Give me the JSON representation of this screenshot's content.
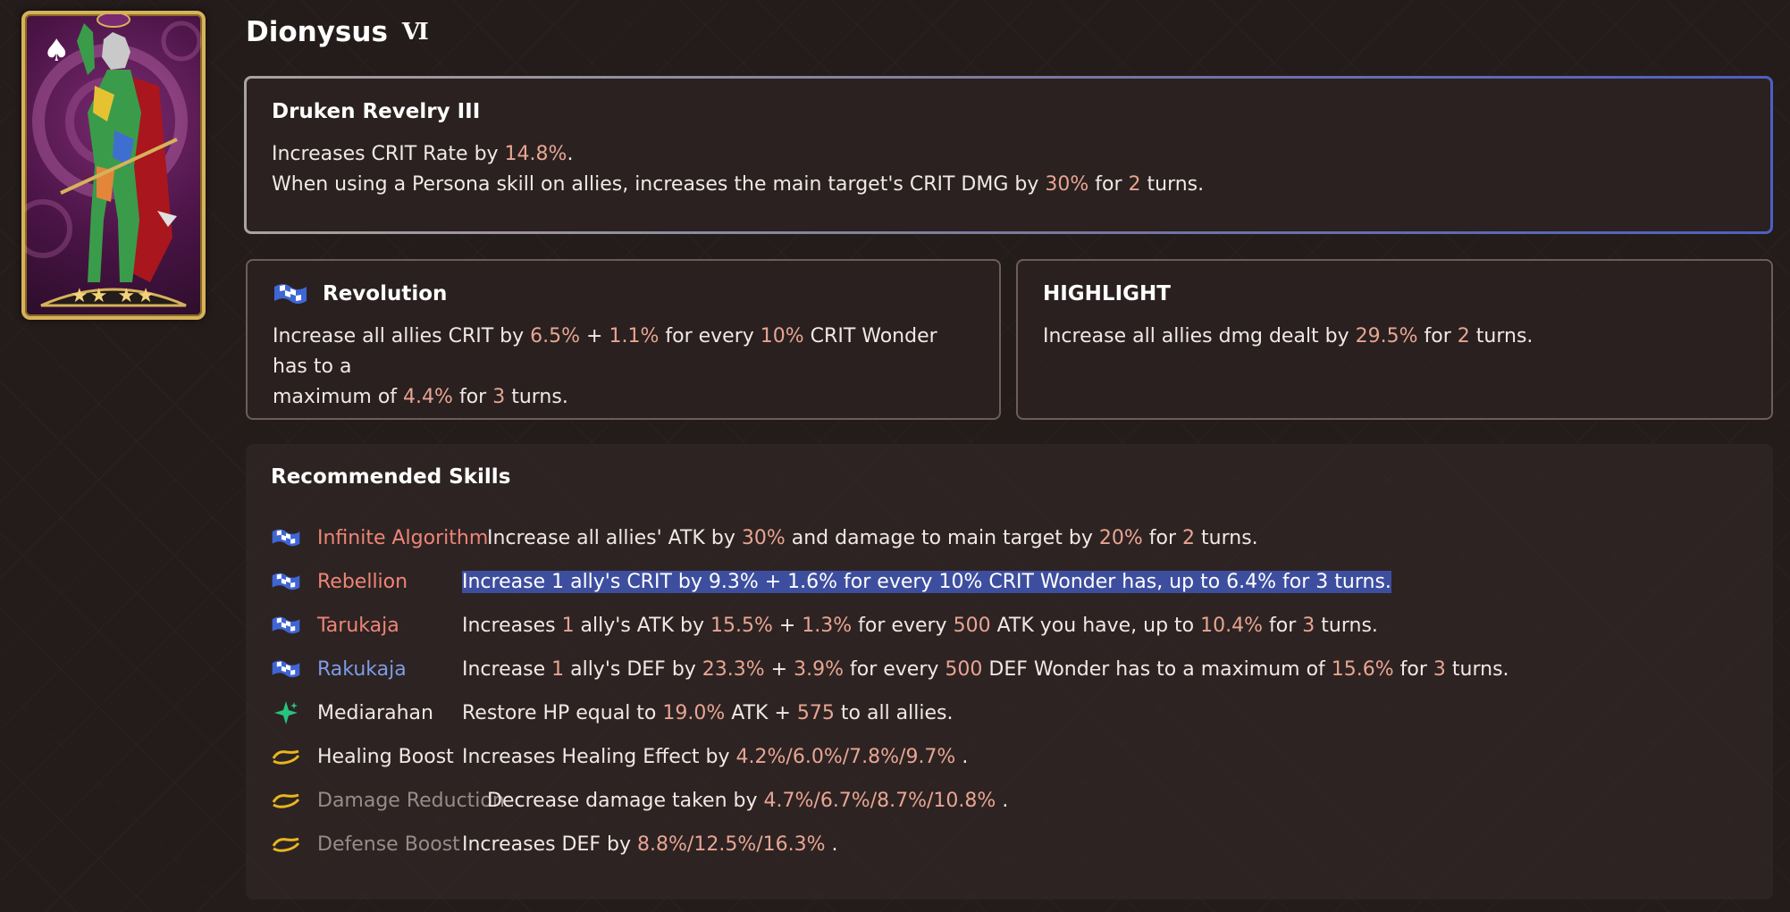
{
  "persona": {
    "name": "Dionysus",
    "tier_badge": "Ⅵ",
    "card": {
      "stars": "★★ ★★",
      "suit_icon": "spade-icon"
    }
  },
  "main_skill": {
    "title": "Druken Revelry III",
    "line1": [
      "Increases CRIT Rate by ",
      "14.8%",
      "."
    ],
    "line2": [
      "When using a Persona skill on allies, increases the main target's CRIT DMG by ",
      "30%",
      " for ",
      "2",
      " turns."
    ]
  },
  "revolution": {
    "icon": "checkered-flag-icon",
    "title": "Revolution",
    "line1": [
      "Increase all allies CRIT by ",
      "6.5%",
      " + ",
      "1.1%",
      " for every ",
      "10%",
      " CRIT Wonder has to a"
    ],
    "line2": [
      "maximum of ",
      "4.4%",
      " for ",
      "3",
      " turns."
    ]
  },
  "highlight": {
    "title": "HIGHLIGHT",
    "line1": [
      "Increase all allies dmg dealt by ",
      "29.5%",
      " for ",
      "2",
      " turns."
    ]
  },
  "recommended": {
    "title": "Recommended Skills",
    "skills": [
      {
        "icon": "checkered-flag-icon",
        "name": "Infinite Algorithm",
        "desc": [
          "Increase all allies' ATK by ",
          "30%",
          " and damage to main target by ",
          "20%",
          " for ",
          "2",
          " turns."
        ]
      },
      {
        "icon": "checkered-flag-icon",
        "name": "Rebellion",
        "desc": [
          "Increase 1 ally's CRIT by 9.3% + 1.6% for every 10% CRIT Wonder has, up to 6.4% for 3 turns."
        ]
      },
      {
        "icon": "checkered-flag-icon",
        "name": "Tarukaja",
        "desc": [
          "Increases ",
          "1",
          " ally's ATK by ",
          "15.5%",
          " + ",
          "1.3%",
          " for every ",
          "500",
          " ATK you have, up to ",
          "10.4%",
          " for ",
          "3",
          " turns."
        ]
      },
      {
        "icon": "checkered-flag-icon",
        "name": "Rakukaja",
        "desc": [
          "Increase ",
          "1",
          " ally's DEF by ",
          "23.3%",
          " + ",
          "3.9%",
          " for every ",
          "500",
          " DEF Wonder has to a maximum of ",
          "15.6%",
          " for ",
          "3",
          " turns."
        ]
      },
      {
        "icon": "sparkle-heal-icon",
        "name": "Mediarahan",
        "desc": [
          "Restore HP equal to ",
          "19.0%",
          " ATK + ",
          "575",
          " to all allies."
        ]
      },
      {
        "icon": "passive-swirl-icon",
        "name": "Healing Boost",
        "desc": [
          "Increases Healing Effect by ",
          "4.2%/6.0%/7.8%/9.7%",
          " ."
        ]
      },
      {
        "icon": "passive-swirl-icon",
        "name": "Damage Reduction",
        "desc": [
          "Decrease damage taken by ",
          "4.7%/6.7%/8.7%/10.8%",
          " ."
        ]
      },
      {
        "icon": "passive-swirl-icon",
        "name": "Defense Boost",
        "desc": [
          "Increases DEF by ",
          "8.8%/12.5%/16.3%",
          " ."
        ]
      }
    ]
  },
  "colors": {
    "accent_number": "#e8a593",
    "skill_red": "#ee8577",
    "skill_blue": "#7d9ce6",
    "skill_grey": "#978c88",
    "selection": "#3e4e9f"
  }
}
